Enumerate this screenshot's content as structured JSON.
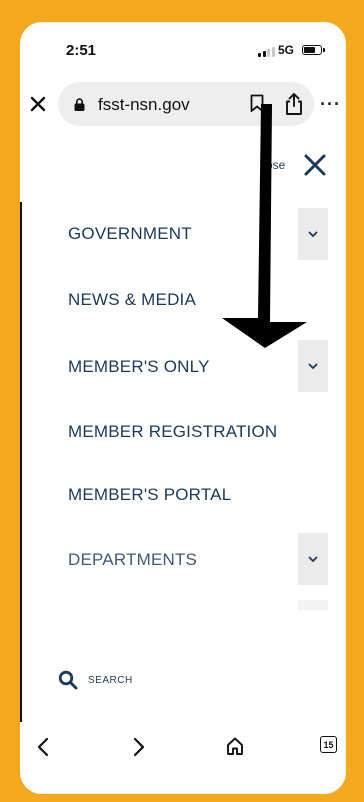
{
  "status": {
    "time": "2:51",
    "network": "5G"
  },
  "browser": {
    "url": "fsst-nsn.gov"
  },
  "nav": {
    "close_label": "ose",
    "items": [
      {
        "label": "GOVERNMENT",
        "has_submenu": true
      },
      {
        "label": "NEWS & MEDIA",
        "has_submenu": false
      },
      {
        "label": "MEMBER'S ONLY",
        "has_submenu": true
      },
      {
        "label": "MEMBER REGISTRATION",
        "has_submenu": false
      },
      {
        "label": "MEMBER'S PORTAL",
        "has_submenu": false
      },
      {
        "label": "DEPARTMENTS",
        "has_submenu": true
      }
    ],
    "search_label": "SEARCH"
  },
  "toolbar": {
    "tabs_count": "15"
  },
  "colors": {
    "frame": "#f4a81d",
    "nav_text": "#1b3a5a",
    "annotation_arrow": "#000000"
  }
}
